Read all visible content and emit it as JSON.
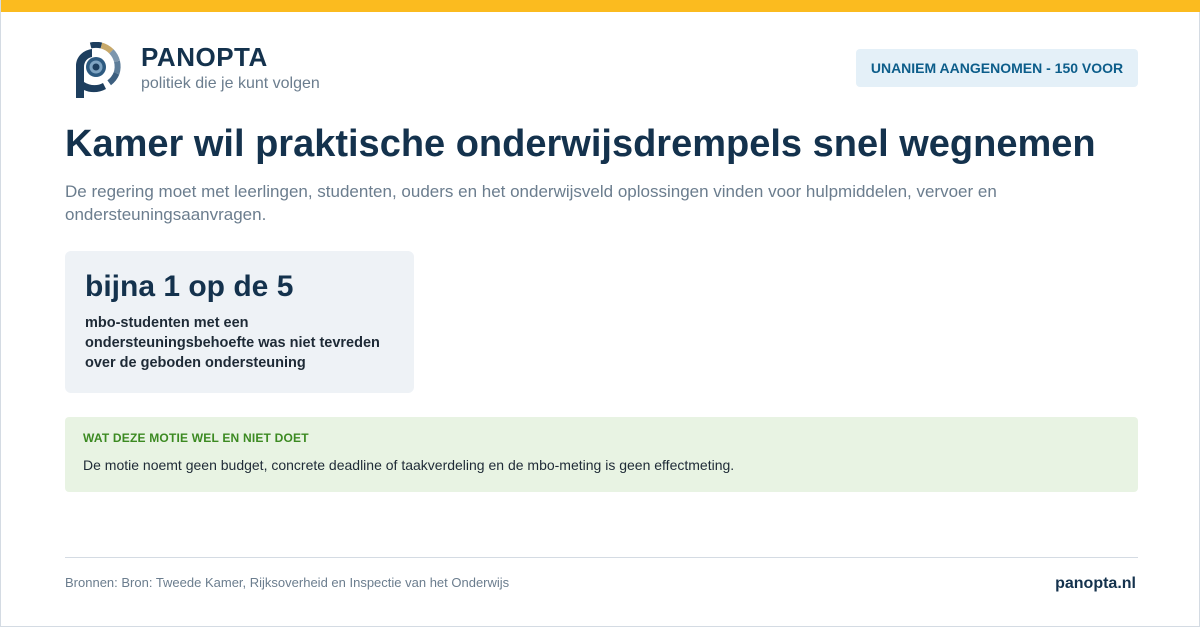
{
  "brand": {
    "name": "PANOPTA",
    "tagline": "politiek die je kunt volgen"
  },
  "status_badge": "UNANIEM AANGENOMEN - 150 VOOR",
  "headline": "Kamer wil praktische onderwijsdrempels snel wegnemen",
  "lead": "De regering moet met leerlingen, studenten, ouders en het onderwijsveld oplossingen vinden voor hulpmiddelen, vervoer en ondersteuningsaanvragen.",
  "stat": {
    "value": "bijna 1 op de 5",
    "label": "mbo-studenten met een ondersteuningsbehoefte was niet tevreden over de geboden ondersteuning"
  },
  "note": {
    "heading": "WAT DEZE MOTIE WEL EN NIET DOET",
    "text": "De motie noemt geen budget, concrete deadline of taakverdeling en de mbo-meting is geen effectmeting."
  },
  "footer": {
    "sources": "Bronnen: Bron: Tweede Kamer, Rijksoverheid en Inspectie van het Onderwijs",
    "site": "panopta.nl"
  },
  "colors": {
    "accent_bar": "#fbbb1f",
    "navy": "#14324d",
    "muted": "#6b7d8e",
    "badge_bg": "#e4f0f8",
    "badge_text": "#0c5d8a",
    "note_bg": "#e8f3e3",
    "note_heading": "#3c8a22",
    "stat_bg": "#eef2f6"
  },
  "icons": {
    "logo": "panopta-eye-logo-icon"
  }
}
